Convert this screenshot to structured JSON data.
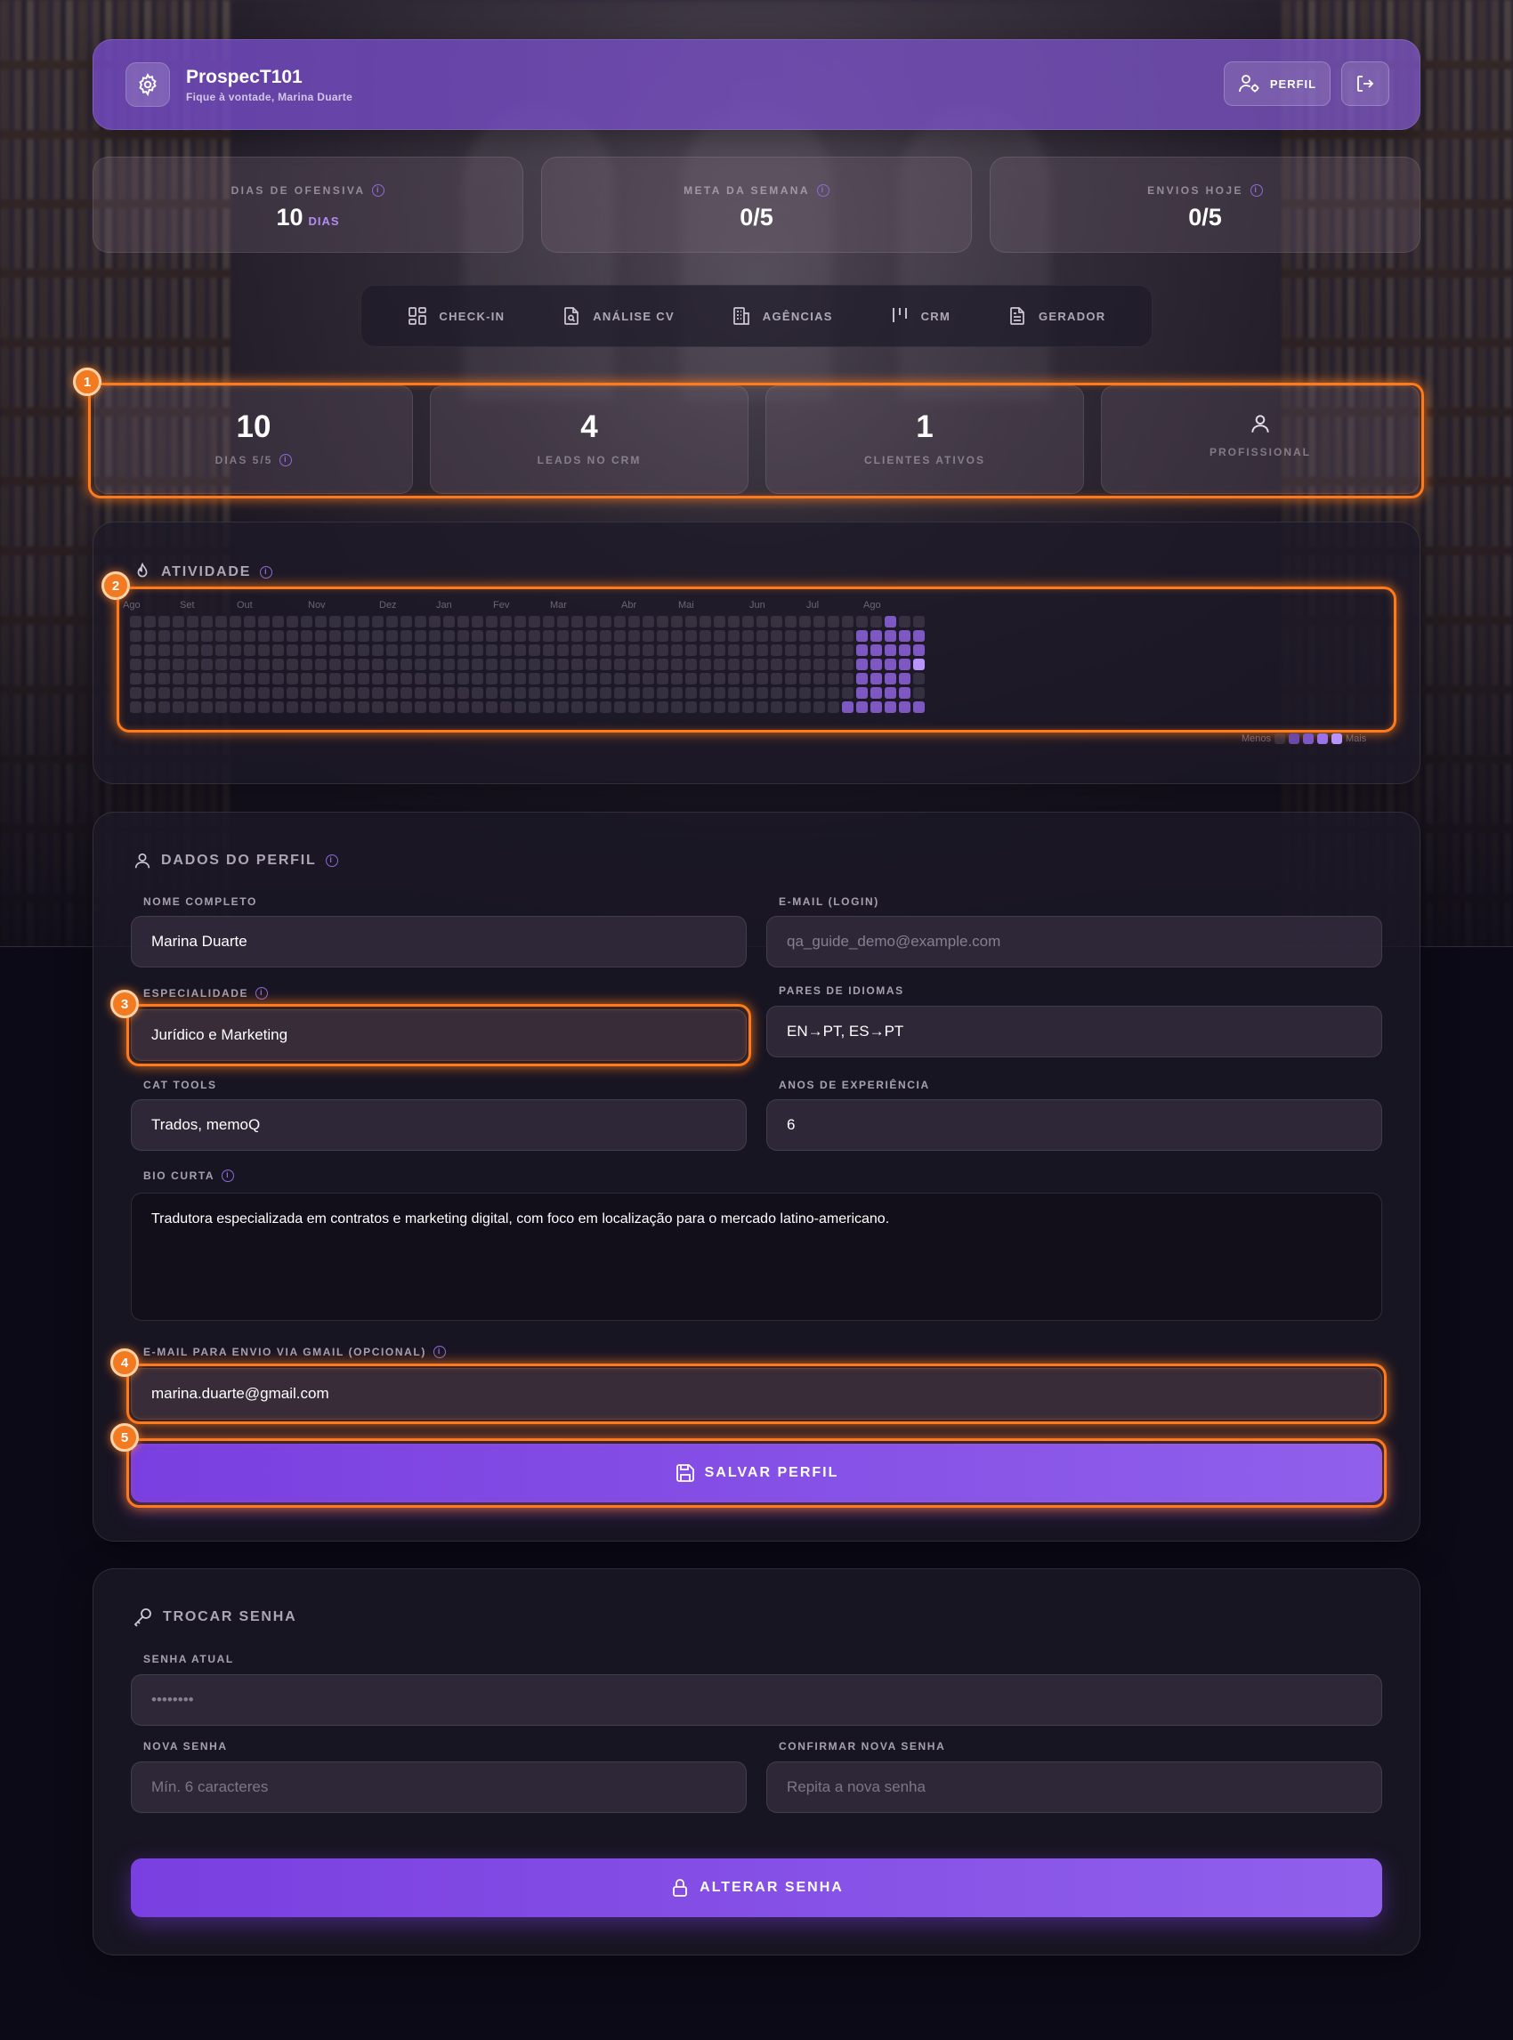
{
  "header": {
    "title": "ProspecT101",
    "subtitle": "Fique à vontade, Marina Duarte",
    "profile_label": "PERFIL"
  },
  "stats": [
    {
      "label": "DIAS DE OFENSIVA",
      "value": "10",
      "unit": "DIAS"
    },
    {
      "label": "META DA SEMANA",
      "value": "0/5"
    },
    {
      "label": "ENVIOS HOJE",
      "value": "0/5"
    }
  ],
  "nav": [
    {
      "label": "CHECK-IN",
      "icon": "grid-icon"
    },
    {
      "label": "ANÁLISE CV",
      "icon": "file-search-icon"
    },
    {
      "label": "AGÊNCIAS",
      "icon": "building-icon"
    },
    {
      "label": "CRM",
      "icon": "kanban-icon"
    },
    {
      "label": "GERADOR",
      "icon": "document-icon"
    }
  ],
  "metrics": [
    {
      "value": "10",
      "label": "DIAS 5/5"
    },
    {
      "value": "4",
      "label": "LEADS NO CRM"
    },
    {
      "value": "1",
      "label": "CLIENTES ATIVOS"
    },
    {
      "label": "PROFISSIONAL",
      "icon": "user-icon"
    }
  ],
  "activity": {
    "title": "ATIVIDADE",
    "months": [
      "Ago",
      "Set",
      "Out",
      "Nov",
      "Dez",
      "Jan",
      "Fev",
      "Mar",
      "Abr",
      "Mai",
      "Jun",
      "Jul",
      "Ago"
    ],
    "legend_less": "Menos",
    "legend_more": "Mais"
  },
  "profile": {
    "title": "DADOS DO PERFIL",
    "full_name_label": "NOME COMPLETO",
    "full_name": "Marina Duarte",
    "email_label": "E-MAIL (LOGIN)",
    "email": "qa_guide_demo@example.com",
    "specialty_label": "ESPECIALIDADE",
    "specialty": "Jurídico e Marketing",
    "languages_label": "PARES DE IDIOMAS",
    "languages": "EN→PT, ES→PT",
    "cat_label": "CAT TOOLS",
    "cat": "Trados, memoQ",
    "years_label": "ANOS DE EXPERIÊNCIA",
    "years": "6",
    "bio_label": "BIO CURTA",
    "bio": "Tradutora especializada em contratos e marketing digital, com foco em localização para o mercado latino-americano.",
    "gmail_label": "E-MAIL PARA ENVIO VIA GMAIL (OPCIONAL)",
    "gmail": "marina.duarte@gmail.com",
    "save_label": "SALVAR PERFIL"
  },
  "password": {
    "title": "TROCAR SENHA",
    "current_label": "SENHA ATUAL",
    "current_value": "••••••••",
    "new_label": "NOVA SENHA",
    "new_placeholder": "Mín. 6 caracteres",
    "confirm_label": "CONFIRMAR NOVA SENHA",
    "confirm_placeholder": "Repita a nova senha",
    "submit_label": "ALTERAR SENHA"
  },
  "highlights": [
    "1",
    "2",
    "3",
    "4",
    "5"
  ],
  "colors": {
    "accent": "#8b5cf6",
    "highlight": "#ff7a1a"
  }
}
